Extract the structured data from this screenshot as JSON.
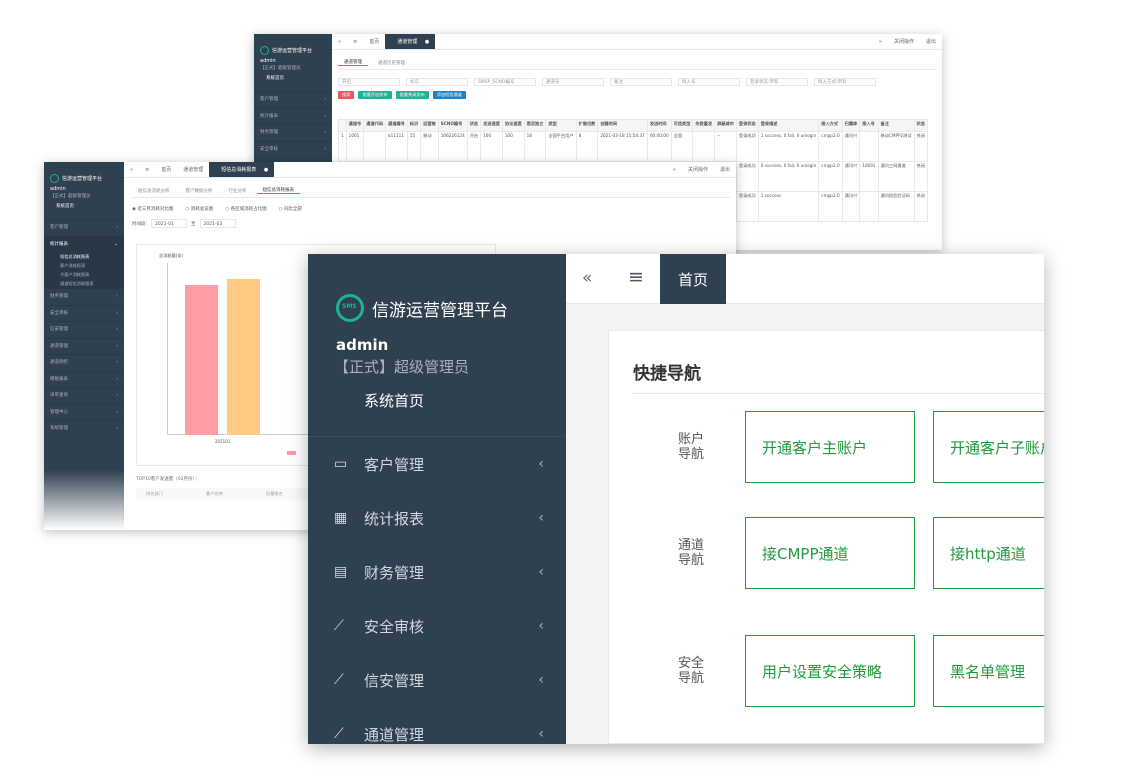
{
  "back_window": {
    "brand": "信游运营管理平台",
    "user": "admin",
    "role": "【正式】超级管理员",
    "home": "系统首页",
    "menu": [
      "客户管理",
      "统计报表",
      "财务管理",
      "安全审核"
    ],
    "tabs": [
      "首页",
      "通道管理"
    ],
    "right_tools": [
      "关闭操作",
      "退出"
    ],
    "subtabs": [
      "通道管理",
      "通道历史管理"
    ],
    "filters": [
      "开启",
      "标识",
      "SMSP_SCNO编号",
      "通道号",
      "备注",
      "接入号",
      "登录状态:所有",
      "接入方式:所有"
    ],
    "buttons": [
      "搜索",
      "批量开启发布",
      "批量关闭发布",
      "添加短信通道"
    ],
    "table": {
      "headers": [
        "",
        "通道号",
        "通道代码",
        "通道编号",
        "标识",
        "运营商",
        "SCNO编号",
        "状态",
        "发送速度",
        "协议速度",
        "是否独立",
        "类型",
        "扩展位数",
        "创建时间",
        "发送时间",
        "可信类型",
        "失败重发",
        "屏蔽城市",
        "登录状态",
        "登录描述",
        "接入方式",
        "归属库",
        "接入号",
        "备注",
        "状态"
      ],
      "rows": [
        [
          "1",
          "1001",
          "",
          "b11111",
          "15",
          "移动",
          "106226124",
          "开启",
          "100",
          "100",
          "16",
          "全国平台用户",
          "8",
          "2021-03-18 15:54:37",
          "00:00:00",
          "全国",
          "",
          "--",
          "登录成功",
          "1 success, 0 fail, 0 unlogin",
          "cmpp2.0",
          "通讯兴",
          "",
          "移动CMPP2测试",
          "关闭"
        ],
        [
          "",
          "",
          "",
          "",
          "",
          "",
          "",
          "",
          "",
          "",
          "",
          "",
          "",
          "",
          "",
          "",
          "",
          "--",
          "登录成功",
          "0 success, 0 fail, 0 unlogin",
          "cmpp2.0",
          "通讯兴",
          "10691",
          "通讯三网通道",
          "关闭"
        ],
        [
          "",
          "",
          "",
          "",
          "",
          "",
          "",
          "",
          "",
          "",
          "",
          "",
          "",
          "",
          "",
          "",
          "",
          "--",
          "登录成功",
          "1 success",
          "cmpp2.0",
          "通讯兴",
          "",
          "通讯短信验证码",
          "关闭"
        ]
      ]
    }
  },
  "mid_window": {
    "brand": "信游运营管理平台",
    "user": "admin",
    "role": "【正式】超级管理员",
    "home": "系统首页",
    "menu": [
      {
        "label": "客户管理",
        "open": false
      },
      {
        "label": "统计报表",
        "open": true,
        "children": [
          "短信总消耗报表",
          "客户消耗报表",
          "子客户消耗报表",
          "通道短信消耗报表"
        ]
      },
      {
        "label": "财务管理",
        "open": false
      },
      {
        "label": "安全审核",
        "open": false
      },
      {
        "label": "信安管理",
        "open": false
      },
      {
        "label": "通道管理",
        "open": false
      },
      {
        "label": "通道调控",
        "open": false
      },
      {
        "label": "模板报表",
        "open": false
      },
      {
        "label": "详单查询",
        "open": false
      },
      {
        "label": "管理中心",
        "open": false
      },
      {
        "label": "系统管理",
        "open": false
      }
    ],
    "tabs": [
      "首页",
      "通道管理",
      "短信总消耗报表"
    ],
    "right_tools": [
      "关闭操作",
      "退出"
    ],
    "subtabs": [
      "短信总消耗分析",
      "客户数据分析",
      "行业分析",
      "短信总消耗报表"
    ],
    "radios": [
      "近三月消耗对比图",
      "消耗总览图",
      "各区域消耗占比图",
      "同比全部"
    ],
    "time_label": "时间段:",
    "time_from": "2021-01",
    "time_to_sep": "至",
    "time_to": "2021-03",
    "chart_ylabel": "总消耗量(条)",
    "chart_xtick": "202101",
    "top_title": "TOP10客户发送量（02月份）：",
    "top_headers": [
      "排名部门",
      "客户名称",
      "扣量排名"
    ]
  },
  "front_window": {
    "brand": "信游运营管理平台",
    "logo_text": "SMS",
    "user": "admin",
    "role": "【正式】超级管理员",
    "home": "系统首页",
    "menu": [
      {
        "icon": "card-icon",
        "glyph": "▭",
        "label": "客户管理"
      },
      {
        "icon": "calculator-icon",
        "glyph": "▦",
        "label": "统计报表"
      },
      {
        "icon": "document-icon",
        "glyph": "▤",
        "label": "财务管理"
      },
      {
        "icon": "line-chart-icon",
        "glyph": "⟋",
        "label": "安全审核"
      },
      {
        "icon": "line-chart-icon",
        "glyph": "⟋",
        "label": "信安管理"
      },
      {
        "icon": "line-chart-icon",
        "glyph": "⟋",
        "label": "通道管理"
      }
    ],
    "topbar": {
      "home_tab": "首页"
    },
    "quick_nav": {
      "title": "快捷导航",
      "groups": [
        {
          "label": "账户导航",
          "buttons": [
            "开通客户主账户",
            "开通客户子账户"
          ]
        },
        {
          "label": "通道导航",
          "buttons": [
            "接CMPP通道",
            "接http通道"
          ]
        },
        {
          "label": "安全导航",
          "buttons": [
            "用户设置安全策略",
            "黑名单管理"
          ]
        }
      ]
    }
  },
  "colors": {
    "sidebar": "#2f4050",
    "accent_green": "#1f9b3c",
    "teal": "#1ab394",
    "bar_pink": "#ff9da7",
    "bar_orange": "#ffcb82"
  }
}
